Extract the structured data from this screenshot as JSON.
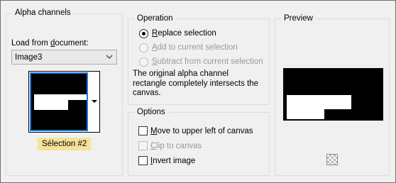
{
  "alpha_channels": {
    "title": "Alpha channels",
    "load_label_pre": "Load from ",
    "load_label_mnemonic": "d",
    "load_label_post": "ocument:",
    "document_value": "Image3",
    "selection_badge": "Sélection #2"
  },
  "operation": {
    "title": "Operation",
    "options": [
      {
        "pre": "",
        "mnemonic": "R",
        "post": "eplace selection",
        "selected": true,
        "enabled": true
      },
      {
        "pre": "",
        "mnemonic": "A",
        "post": "dd to current selection",
        "selected": false,
        "enabled": false
      },
      {
        "pre": "",
        "mnemonic": "S",
        "post": "ubtract from current selection",
        "selected": false,
        "enabled": false
      }
    ],
    "description_lines": [
      "The original alpha channel",
      "rectangle completely intersects the",
      "canvas."
    ]
  },
  "options": {
    "title": "Options",
    "items": [
      {
        "pre": "",
        "mnemonic": "M",
        "post": "ove to upper left of canvas",
        "checked": false,
        "enabled": true
      },
      {
        "pre": "",
        "mnemonic": "C",
        "post": "lip to canvas",
        "checked": false,
        "enabled": false
      },
      {
        "pre": "",
        "mnemonic": "I",
        "post": "nvert image",
        "checked": false,
        "enabled": true
      }
    ]
  },
  "preview": {
    "title": "Preview"
  },
  "icons": {
    "dropdown": "chevron-down-icon",
    "thumbnail_menu": "dropdown-arrow-icon",
    "transparency_toggle": "checkerboard-icon"
  },
  "colors": {
    "accent": "#1c79d6",
    "badge_bg": "#f7e29a"
  }
}
